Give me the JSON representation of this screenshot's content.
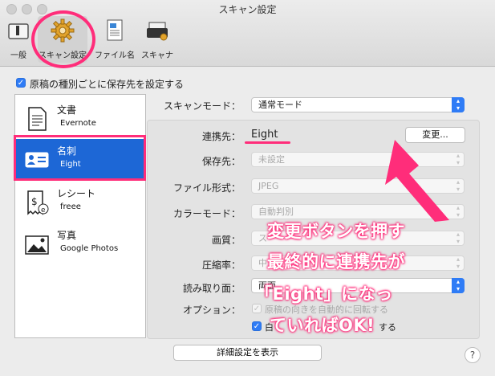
{
  "window": {
    "title": "スキャン設定"
  },
  "toolbar": [
    {
      "label": "一般",
      "icon": "switch-icon"
    },
    {
      "label": "スキャン設定",
      "icon": "gear-icon"
    },
    {
      "label": "ファイル名",
      "icon": "document-icon"
    },
    {
      "label": "スキャナ",
      "icon": "scanner-icon"
    }
  ],
  "top_checkbox": {
    "label": "原稿の種別ごとに保存先を設定する",
    "checked": true
  },
  "sidebar": {
    "items": [
      {
        "title": "文書",
        "subtitle": "Evernote",
        "icon": "document-icon"
      },
      {
        "title": "名刺",
        "subtitle": "Eight",
        "icon": "business-card-icon",
        "selected": true
      },
      {
        "title": "レシート",
        "subtitle": "freee",
        "icon": "receipt-icon"
      },
      {
        "title": "写真",
        "subtitle": "Google Photos",
        "icon": "photo-icon"
      }
    ]
  },
  "form": {
    "scan_mode": {
      "label": "スキャンモード：",
      "value": "通常モード"
    },
    "link": {
      "label": "連携先：",
      "value": "Eight",
      "button": "変更..."
    },
    "save_to": {
      "label": "保存先：",
      "value": "未設定"
    },
    "file_format": {
      "label": "ファイル形式：",
      "value": "JPEG"
    },
    "color_mode": {
      "label": "カラーモード：",
      "value": "自動判別"
    },
    "quality": {
      "label": "画質：",
      "value": "ス"
    },
    "compression": {
      "label": "圧縮率：",
      "value": "中"
    },
    "read_side": {
      "label": "読み取り面：",
      "value": "両面"
    },
    "options": {
      "label": "オプション：",
      "rotate": {
        "label": "原稿の向きを自動的に回転する",
        "checked": true,
        "disabled": true
      },
      "blank": {
        "label": "白",
        "label_tail": "する",
        "checked": true
      }
    }
  },
  "footer": {
    "advanced_button": "詳細設定を表示",
    "help": "?"
  },
  "annotation": {
    "lines": [
      "変更ボタンを押す",
      "最終的に連携先が",
      "「Eight」になっ",
      "ていればOK!"
    ],
    "color": "#ff2d7a"
  },
  "colors": {
    "accent": "#2f7cf6",
    "selection": "#1d67d6",
    "highlight": "#ff2d7a"
  }
}
